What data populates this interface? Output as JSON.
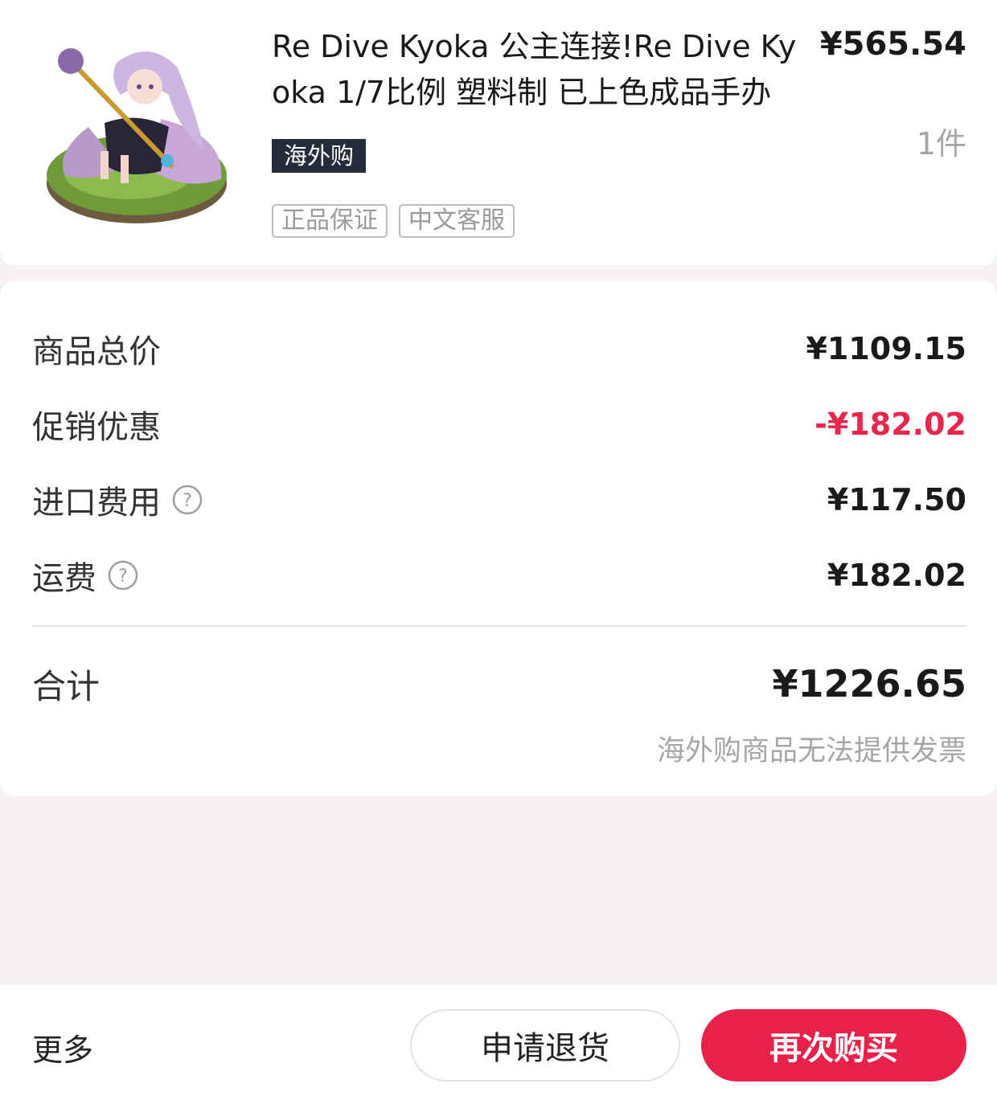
{
  "product": {
    "title": "Re Dive Kyoka 公主连接!Re Dive Kyoka 1/7比例 塑料制 已上色成品手办",
    "price": "¥565.54",
    "quantity": "1件",
    "badge": "海外购",
    "tags": [
      "正品保证",
      "中文客服"
    ]
  },
  "summary": {
    "rows": [
      {
        "label": "商品总价",
        "value": "¥1109.15",
        "help": false
      },
      {
        "label": "促销优惠",
        "value": "-¥182.02",
        "help": false,
        "highlight": "#e8264e"
      },
      {
        "label": "进口费用",
        "value": "¥117.50",
        "help": true
      },
      {
        "label": "运费",
        "value": "¥182.02",
        "help": true
      }
    ],
    "total_label": "合计",
    "total_value": "¥1226.65",
    "invoice_note": "海外购商品无法提供发票"
  },
  "actions": {
    "more": "更多",
    "return_label": "申请退货",
    "rebuy_label": "再次购买"
  },
  "colors": {
    "accent": "#e8214a",
    "discount": "#e8264e",
    "badge_bg": "#252c3b"
  },
  "icons": {
    "help": "question-circle-icon"
  }
}
